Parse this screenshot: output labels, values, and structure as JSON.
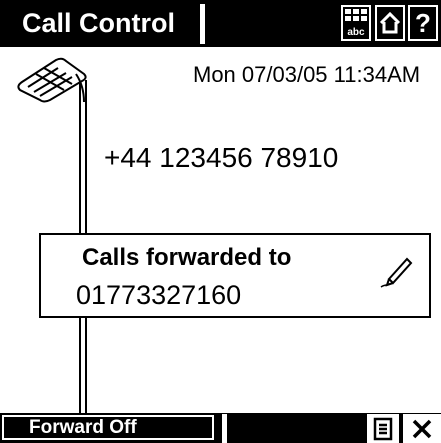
{
  "header": {
    "title": "Call Control",
    "buttons": [
      {
        "name": "keyboard",
        "icon": "keyboard-abc-icon"
      },
      {
        "name": "home",
        "icon": "home-icon"
      },
      {
        "name": "help",
        "icon": "help-icon",
        "label": "?"
      }
    ]
  },
  "call": {
    "icon": "handset-icon",
    "datetime": "Mon 07/03/05 11:34AM",
    "number": "+44 123456 78910"
  },
  "forward": {
    "title": "Calls forwarded to",
    "number": "01773327160",
    "edit_icon": "pencil-icon"
  },
  "footer": {
    "forward_off_label": "Forward Off",
    "menu_icon": "menu-icon",
    "close_icon": "close-icon"
  },
  "colors": {
    "bar": "#000000",
    "background": "#ffffff"
  }
}
